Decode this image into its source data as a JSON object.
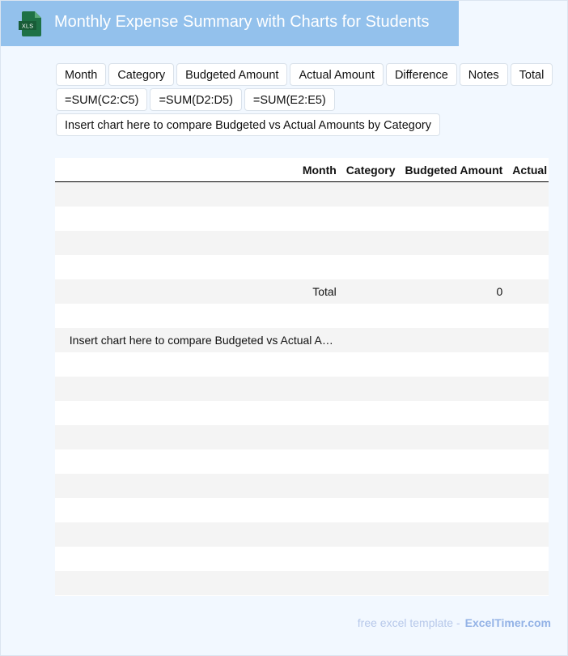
{
  "header": {
    "title": "Monthly Expense Summary with Charts for Students",
    "logo_text": "XLS",
    "icon": "excel-file-icon"
  },
  "chips": {
    "row1": [
      "Month",
      "Category",
      "Budgeted Amount",
      "Actual Amount",
      "Difference",
      "Notes",
      "Total"
    ],
    "row2": [
      "=SUM(C2:C5)",
      "=SUM(D2:D5)",
      "=SUM(E2:E5)"
    ],
    "row3": [
      "Insert chart here to compare Budgeted vs Actual Amounts by Category"
    ]
  },
  "table": {
    "columns": [
      "",
      "Month",
      "Category",
      "Budgeted Amount",
      "Actual Amount"
    ],
    "rows": [
      {
        "idx": "0",
        "month": "",
        "category": "",
        "budgeted": "",
        "actual": ""
      },
      {
        "idx": "1",
        "month": "",
        "category": "",
        "budgeted": "",
        "actual": ""
      },
      {
        "idx": "2",
        "month": "",
        "category": "",
        "budgeted": "",
        "actual": ""
      },
      {
        "idx": "3",
        "month": "",
        "category": "",
        "budgeted": "",
        "actual": ""
      },
      {
        "idx": "4",
        "month": "Total",
        "category": "",
        "budgeted": "0",
        "actual": ""
      },
      {
        "idx": "5",
        "month": "",
        "category": "",
        "budgeted": "",
        "actual": ""
      },
      {
        "idx": "6",
        "month": "Insert chart here to compare Budgeted vs Actual Amounts by Category",
        "category": "",
        "budgeted": "",
        "actual": ""
      },
      {
        "idx": "7",
        "month": "",
        "category": "",
        "budgeted": "",
        "actual": ""
      },
      {
        "idx": "8",
        "month": "",
        "category": "",
        "budgeted": "",
        "actual": ""
      },
      {
        "idx": "9",
        "month": "",
        "category": "",
        "budgeted": "",
        "actual": ""
      },
      {
        "idx": "10",
        "month": "",
        "category": "",
        "budgeted": "",
        "actual": ""
      },
      {
        "idx": "11",
        "month": "",
        "category": "",
        "budgeted": "",
        "actual": ""
      },
      {
        "idx": "12",
        "month": "",
        "category": "",
        "budgeted": "",
        "actual": ""
      },
      {
        "idx": "13",
        "month": "",
        "category": "",
        "budgeted": "",
        "actual": ""
      },
      {
        "idx": "14",
        "month": "",
        "category": "",
        "budgeted": "",
        "actual": ""
      },
      {
        "idx": "15",
        "month": "",
        "category": "",
        "budgeted": "",
        "actual": ""
      },
      {
        "idx": "16",
        "month": "",
        "category": "",
        "budgeted": "",
        "actual": ""
      }
    ]
  },
  "footer": {
    "text": "free excel template -",
    "brand": "ExcelTimer.com"
  },
  "colors": {
    "header_bg": "#93c1ec",
    "excel_green": "#1e7145",
    "footer_brand": "#93b2e6"
  }
}
